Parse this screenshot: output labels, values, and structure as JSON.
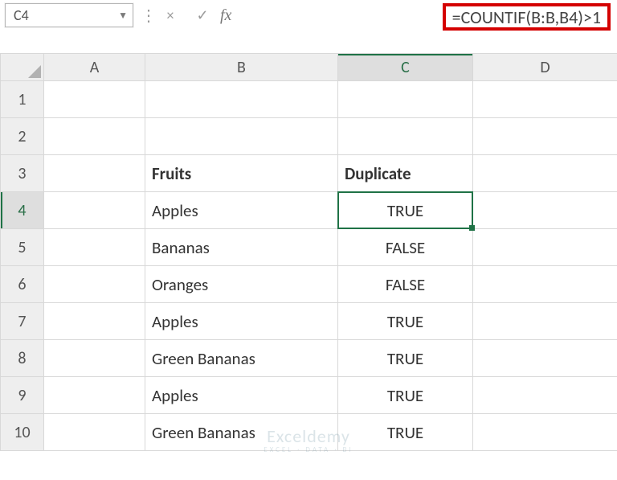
{
  "nameBox": {
    "value": "C4"
  },
  "formulaBar": {
    "cancelIcon": "×",
    "acceptIcon": "✓",
    "fxLabel": "fx",
    "formula": "=COUNTIF(B:B,B4)>1"
  },
  "columns": [
    "A",
    "B",
    "C",
    "D"
  ],
  "rows": [
    "1",
    "2",
    "3",
    "4",
    "5",
    "6",
    "7",
    "8",
    "9",
    "10"
  ],
  "activeCell": {
    "col": "C",
    "row": "4"
  },
  "headers": {
    "B3": "Fruits",
    "C3": "Duplicate"
  },
  "dataB": {
    "4": "Apples",
    "5": "Bananas",
    "6": "Oranges",
    "7": "Apples",
    "8": "Green Bananas",
    "9": "Apples",
    "10": "Green Bananas"
  },
  "dataC": {
    "4": "TRUE",
    "5": "FALSE",
    "6": "FALSE",
    "7": "TRUE",
    "8": "TRUE",
    "9": "TRUE",
    "10": "TRUE"
  },
  "watermark": {
    "brand": "Exceldemy",
    "tag": "EXCEL · DATA · BI"
  }
}
